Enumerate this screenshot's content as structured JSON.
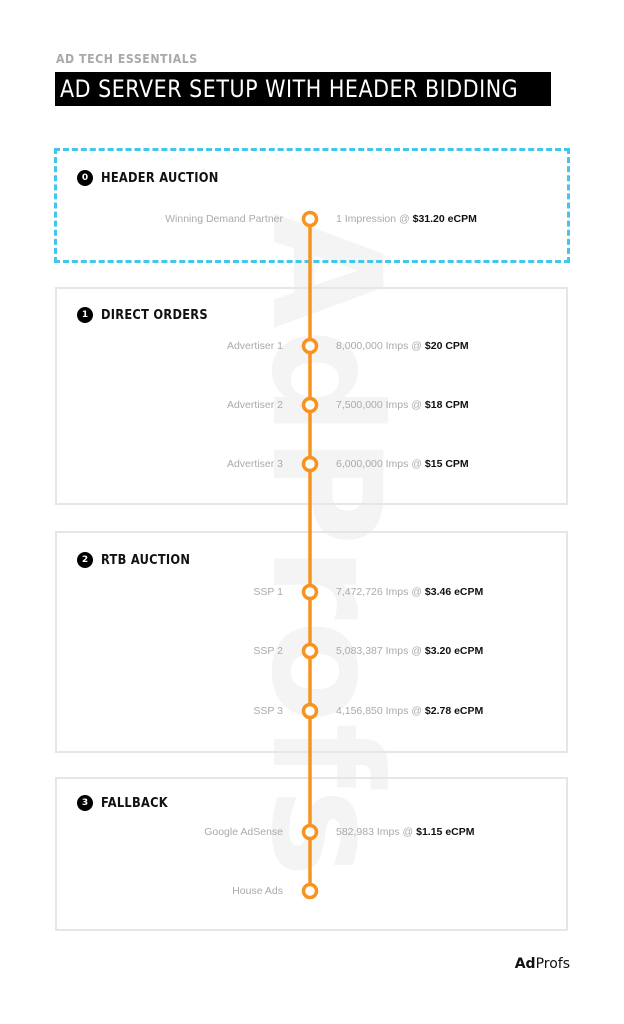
{
  "header": {
    "kicker": "AD TECH ESSENTIALS",
    "title": "AD SERVER SETUP WITH HEADER BIDDING"
  },
  "colors": {
    "timeline": "#f7931e",
    "dashed_border": "#44c5ee",
    "box_border": "#e6e6e6",
    "title_bg": "#000000",
    "label_gray": "#aaaaaa"
  },
  "watermark": "AdProfs",
  "sections": [
    {
      "number": "0",
      "title": "HEADER AUCTION",
      "style": "dashed",
      "items": [
        {
          "name": "Winning Demand Partner",
          "volume": "1 Impression @",
          "price": "$31.20 eCPM"
        }
      ]
    },
    {
      "number": "1",
      "title": "DIRECT ORDERS",
      "style": "solid",
      "items": [
        {
          "name": "Advertiser 1",
          "volume": "8,000,000 Imps @",
          "price": "$20 CPM"
        },
        {
          "name": "Advertiser 2",
          "volume": "7,500,000 Imps @",
          "price": "$18 CPM"
        },
        {
          "name": "Advertiser 3",
          "volume": "6,000,000 Imps @",
          "price": "$15 CPM"
        }
      ]
    },
    {
      "number": "2",
      "title": "RTB AUCTION",
      "style": "solid",
      "items": [
        {
          "name": "SSP 1",
          "volume": "7,472,726 Imps @",
          "price": "$3.46 eCPM"
        },
        {
          "name": "SSP 2",
          "volume": "5,083,387 Imps @",
          "price": "$3.20 eCPM"
        },
        {
          "name": "SSP 3",
          "volume": "4,156,850 Imps @",
          "price": "$2.78 eCPM"
        }
      ]
    },
    {
      "number": "3",
      "title": "FALLBACK",
      "style": "solid",
      "items": [
        {
          "name": "Google AdSense",
          "volume": "582,983 Imps @",
          "price": "$1.15 eCPM"
        },
        {
          "name": "House Ads",
          "volume": "",
          "price": ""
        }
      ]
    }
  ],
  "footer": {
    "logo_bold": "Ad",
    "logo_regular": "Profs"
  }
}
